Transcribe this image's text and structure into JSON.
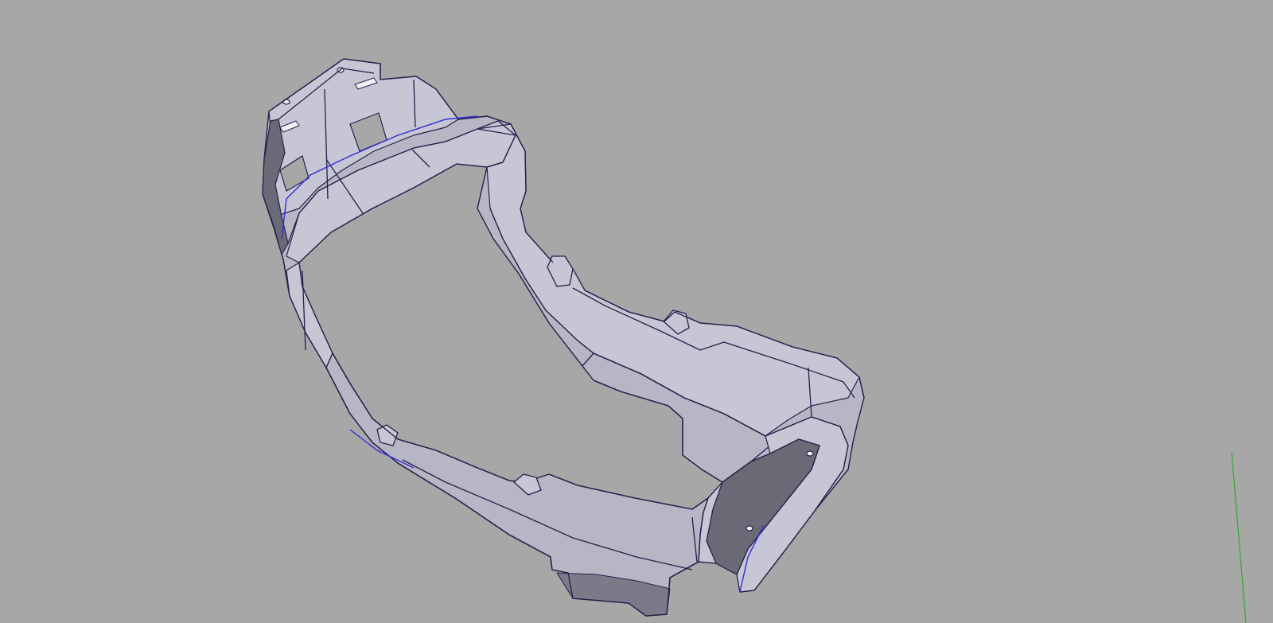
{
  "viewport": {
    "background_color": "#a7a7a7",
    "part_surface_color": "#b6b6c4",
    "part_surface_light_color": "#c6c6d4",
    "part_shadow_color": "#7a7a88",
    "part_dark_color": "#6a6a76",
    "edge_color": "#2a1e4a",
    "edge_highlight_color": "#2f2fd8",
    "hole_color": "#f2f2f2",
    "axis_y_color": "#2eaa2e"
  }
}
